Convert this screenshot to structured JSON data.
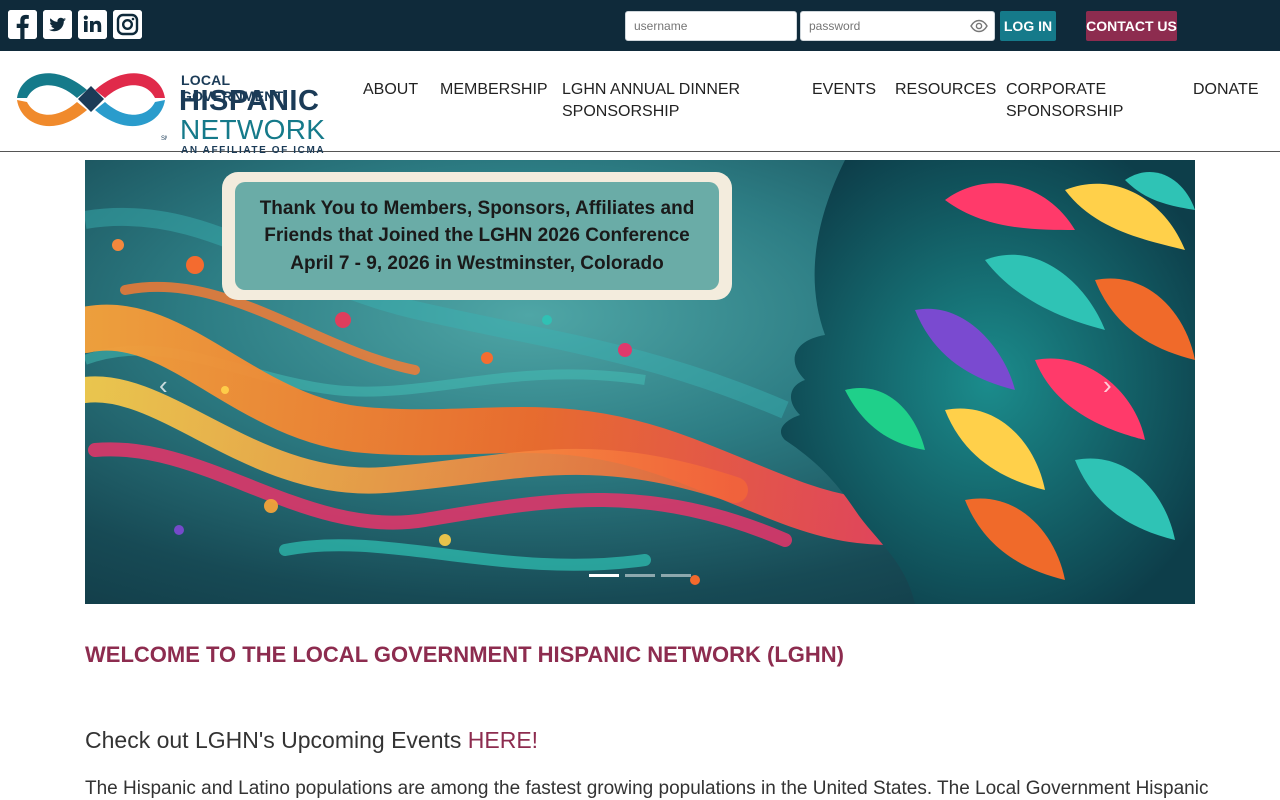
{
  "social": {
    "icons": [
      "facebook-icon",
      "twitter-icon",
      "linkedin-icon",
      "instagram-icon"
    ]
  },
  "login": {
    "username_placeholder": "username",
    "password_placeholder": "password",
    "login_label": "LOG IN",
    "contact_label": "CONTACT US"
  },
  "logo": {
    "line1": "LOCAL GOVERNMENT",
    "line2": "HISPANIC",
    "line3": "NETWORK",
    "line4": "AN AFFILIATE OF ICMA"
  },
  "nav": {
    "about": "ABOUT",
    "membership": "MEMBERSHIP",
    "dinner_line1": "LGHN ANNUAL DINNER",
    "dinner_line2": "SPONSORSHIP",
    "events": "EVENTS",
    "resources": "RESOURCES",
    "corporate_line1": "CORPORATE",
    "corporate_line2": "SPONSORSHIP",
    "donate": "DONATE"
  },
  "carousel": {
    "line1": "Thank You to Members, Sponsors, Affiliates and",
    "line2": "Friends that Joined the LGHN 2026 Conference",
    "line3": "April 7 - 9, 2026 in Westminster, Colorado",
    "prev_icon": "chevron-left-icon",
    "next_icon": "chevron-right-icon",
    "slide_count": 3,
    "active_slide": 1
  },
  "content": {
    "welcome": "WELCOME TO THE LOCAL GOVERNMENT HISPANIC NETWORK (LGHN)",
    "upcoming_prefix": "Check out LGHN's Upcoming Events ",
    "upcoming_link": "HERE!",
    "paragraph": "The Hispanic and Latino populations are among the fastest growing populations in the United States. The Local Government Hispanic"
  },
  "colors": {
    "topbar": "#0f2a3a",
    "teal": "#157a8a",
    "maroon": "#8d2c4f",
    "navy": "#1b3b57"
  }
}
